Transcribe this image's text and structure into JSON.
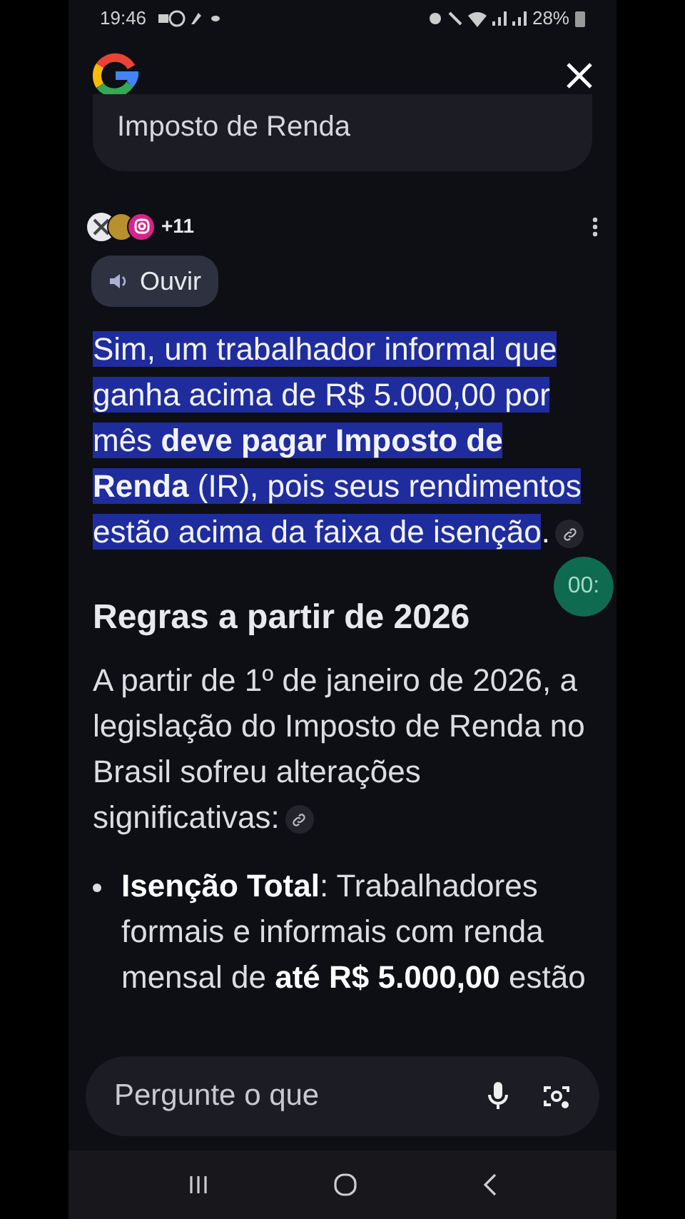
{
  "status_bar": {
    "time": "19:46",
    "battery": "28%"
  },
  "query": {
    "text": "Imposto de Renda"
  },
  "sources": {
    "count": "+11"
  },
  "listen_button": {
    "label": "Ouvir"
  },
  "answer": {
    "text": "Sim, um trabalhador informal que ganha acima de R$ 5.000,00 por mês **deve pagar Imposto de Renda** (IR), pois seus rendimentos estão acima da faixa de isenção",
    "highlighted": true,
    "end": "."
  },
  "section": {
    "heading": "Regras a partir de 2026",
    "paragraph": "A partir de 1º de janeiro de 2026, a legislação do Imposto de Renda no Brasil sofreu alterações significativas:",
    "bullets": [
      {
        "text": "**Isenção Total**: Trabalhadores formais e informais com renda mensal de **até R$ 5.000,00** estão"
      }
    ]
  },
  "timer": {
    "text": "00:"
  },
  "search": {
    "placeholder": "Pergunte o que"
  }
}
